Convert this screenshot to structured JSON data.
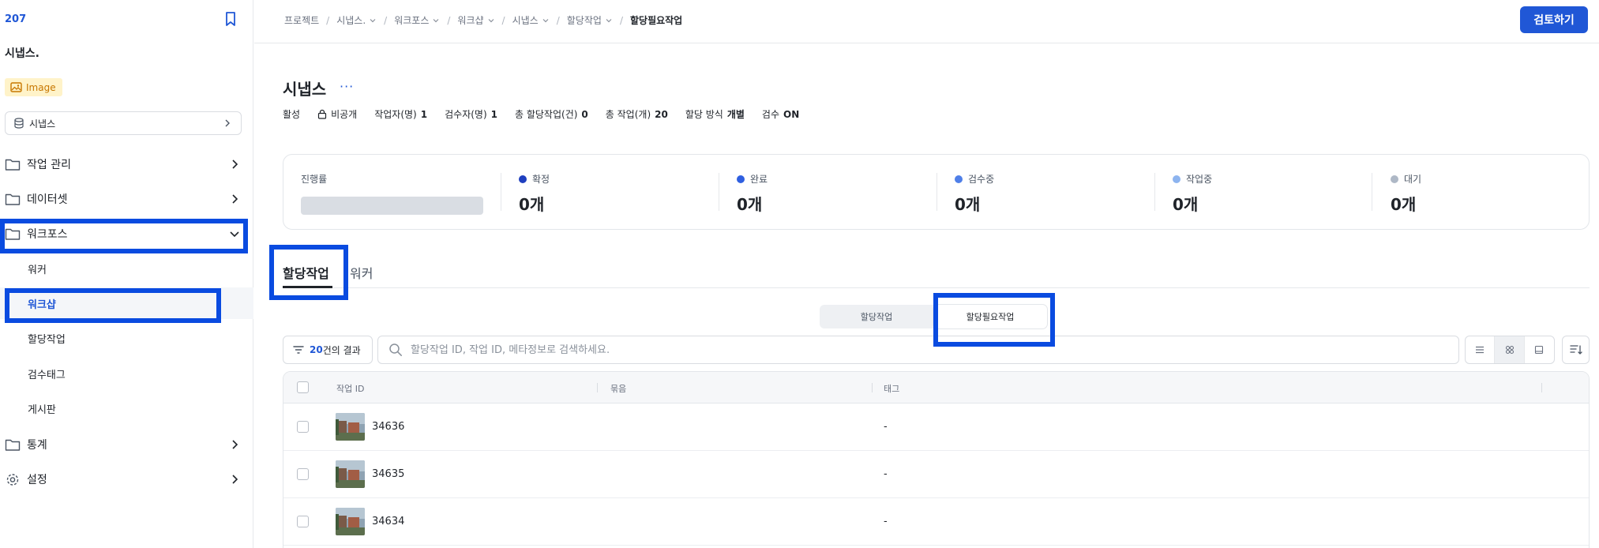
{
  "sidebar": {
    "project_number": "207",
    "project_name": "시냅스.",
    "badge_label": "Image",
    "dataset_label": "시냅스",
    "menu": {
      "task_mgmt": "작업 관리",
      "dataset": "데이터셋",
      "workforce": "워크포스",
      "worker": "워커",
      "workshop": "워크샵",
      "assigned_tasks": "할당작업",
      "review_tags": "검수태그",
      "board": "게시판",
      "stats": "통계",
      "settings": "설정"
    }
  },
  "topbar": {
    "breadcrumbs": [
      "프로젝트",
      "시냅스.",
      "워크포스",
      "워크샵",
      "시냅스",
      "할당작업",
      "할당필요작업"
    ],
    "review_button": "검토하기"
  },
  "header": {
    "title": "시냅스",
    "more": "···",
    "meta": {
      "status": "활성",
      "visibility": "비공개",
      "workers_label": "작업자(명)",
      "workers_value": "1",
      "reviewers_label": "검수자(명)",
      "reviewers_value": "1",
      "assigned_label": "총 할당작업(건)",
      "assigned_value": "0",
      "tasks_label": "총 작업(개)",
      "tasks_value": "20",
      "method_label": "할당 방식",
      "method_value": "개별",
      "review_label": "검수",
      "review_value": "ON"
    }
  },
  "stats": {
    "progress_label": "진행률",
    "progress_fraction": 0,
    "items": [
      {
        "label": "확정",
        "value": "0개",
        "color": "#1f3fbf"
      },
      {
        "label": "완료",
        "value": "0개",
        "color": "#2f5fe0"
      },
      {
        "label": "검수중",
        "value": "0개",
        "color": "#4f7fe8"
      },
      {
        "label": "작업중",
        "value": "0개",
        "color": "#8db4ef"
      },
      {
        "label": "대기",
        "value": "0개",
        "color": "#aeb8c6"
      }
    ]
  },
  "tabs": {
    "active": "할당작업",
    "other": "워커"
  },
  "segment": {
    "option1": "할당작업",
    "option2": "할당필요작업"
  },
  "toolbar": {
    "count_value": "20",
    "count_suffix": "건의 결과",
    "search_placeholder": "할당작업 ID, 작업 ID, 메타정보로 검색하세요."
  },
  "table": {
    "columns": [
      "작업 ID",
      "묶음",
      "태그"
    ],
    "rows": [
      {
        "id": "34636",
        "tag": "-"
      },
      {
        "id": "34635",
        "tag": "-"
      },
      {
        "id": "34634",
        "tag": "-"
      }
    ]
  },
  "colors": {
    "accent": "#2057d6",
    "highlight": "#0a4be0"
  }
}
